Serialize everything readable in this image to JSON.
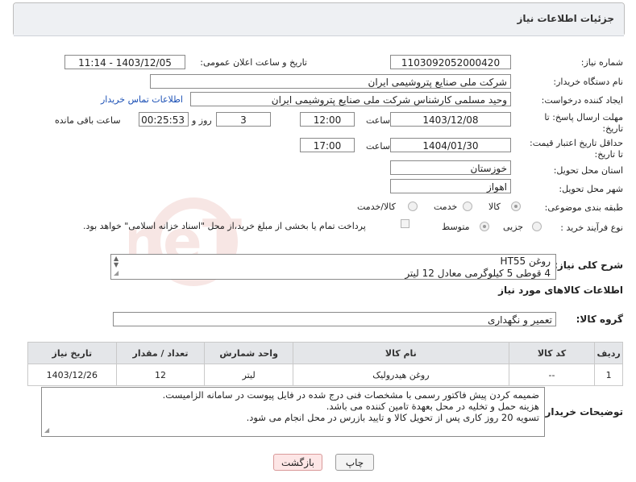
{
  "header": {
    "title": "جزئیات اطلاعات نیاز"
  },
  "form": {
    "need_number_label": "شماره نیاز:",
    "need_number": "1103092052000420",
    "announce_label": "تاریخ و ساعت اعلان عمومی:",
    "announce_value": "1403/12/05 - 11:14",
    "buyer_org_label": "نام دستگاه خریدار:",
    "buyer_org": "شرکت ملی صنایع پتروشیمی ایران",
    "creator_label": "ایجاد کننده درخواست:",
    "creator": "وحید مسلمی کارشناس شرکت ملی صنایع پتروشیمی ایران",
    "contact_link": "اطلاعات تماس خریدار",
    "deadline_label": "مهلت ارسال پاسخ: تا تاریخ:",
    "deadline_date": "1403/12/08",
    "time_label": "ساعت",
    "deadline_time": "12:00",
    "days": "3",
    "days_label": "روز و",
    "remaining": "00:25:53",
    "remaining_label": "ساعت باقی مانده",
    "validity_label": "حداقل تاریخ اعتبار قیمت: تا تاریخ:",
    "validity_date": "1404/01/30",
    "validity_time_label": "ساعت",
    "validity_time": "17:00",
    "province_label": "استان محل تحویل:",
    "province": "خوزستان",
    "city_label": "شهر محل تحویل:",
    "city": "اهواز",
    "category_label": "طبقه بندی موضوعی:",
    "category_options": [
      "کالا",
      "خدمت",
      "کالا/خدمت"
    ],
    "process_label": "نوع فرآیند خرید :",
    "process_options": [
      "جزیی",
      "متوسط"
    ],
    "payment_note": "پرداخت تمام یا بخشی از مبلغ خرید،از محل \"اسناد خزانه اسلامی\" خواهد بود."
  },
  "description": {
    "label": "شرح کلی نیاز:",
    "line1": "روغن HT55",
    "line2": "4 قوطی 5 کیلوگرمی معادل 12 لیتر"
  },
  "goods": {
    "section_title": "اطلاعات کالاهای مورد نیاز",
    "group_label": "گروه کالا:",
    "group_value": "تعمیر و نگهداری",
    "columns": [
      "ردیف",
      "کد کالا",
      "نام کالا",
      "واحد شمارش",
      "تعداد / مقدار",
      "تاریخ نیاز"
    ],
    "rows": [
      [
        "1",
        "--",
        "روغن هیدرولیک",
        "لیتر",
        "12",
        "1403/12/26"
      ]
    ]
  },
  "buyer_notes": {
    "label": "توضیحات خریدار:",
    "line1": "ضمیمه کردن پیش فاکتور رسمی با مشخصات فنی درج شده در فایل پیوست در سامانه الزامیست.",
    "line2": "هزینه حمل و تخلیه در محل بعهدة تامین کننده می باشد.",
    "line3": "تسویه 20 روز کاری پس از تحویل کالا و تایید بازرس در محل انجام می شود."
  },
  "buttons": {
    "print": "چاپ",
    "back": "بازگشت"
  },
  "watermark": "AriaTender.neT"
}
